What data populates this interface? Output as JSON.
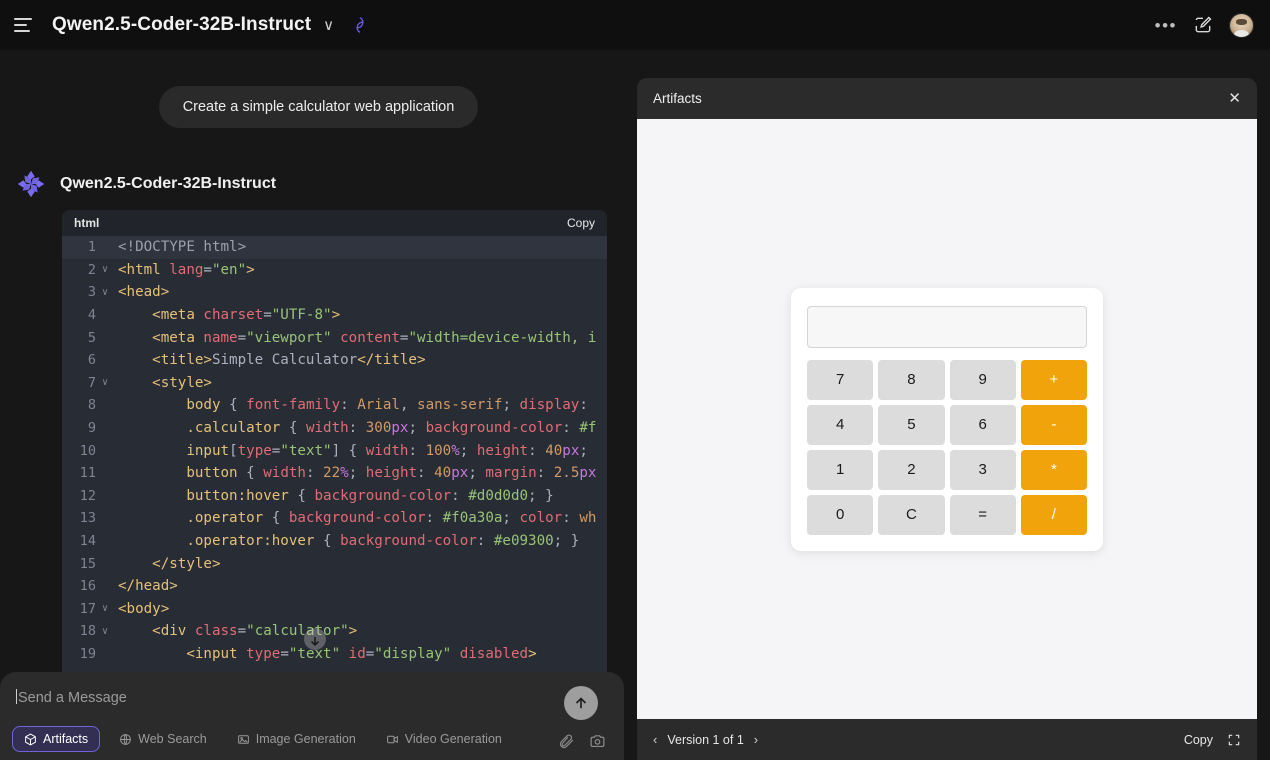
{
  "topbar": {
    "menu_icon": "hamburger-icon",
    "model_name": "Qwen2.5-Coder-32B-Instruct",
    "chevron": "∨",
    "brand_icon": "qwen-logo-icon",
    "more_label": "•••",
    "edit_icon": "edit-square-icon",
    "avatar_icon": "user-avatar"
  },
  "chat": {
    "user_message": "Create a simple calculator web application",
    "assistant_name": "Qwen2.5-Coder-32B-Instruct",
    "assistant_avatar": "qwen-logo-icon"
  },
  "code": {
    "language": "html",
    "copy_label": "Copy",
    "lines": [
      {
        "n": "1",
        "fold": "",
        "active": true
      },
      {
        "n": "2",
        "fold": "∨",
        "active": false
      },
      {
        "n": "3",
        "fold": "∨",
        "active": false
      },
      {
        "n": "4",
        "fold": "",
        "active": false
      },
      {
        "n": "5",
        "fold": "",
        "active": false
      },
      {
        "n": "6",
        "fold": "",
        "active": false
      },
      {
        "n": "7",
        "fold": "∨",
        "active": false
      },
      {
        "n": "8",
        "fold": "",
        "active": false
      },
      {
        "n": "9",
        "fold": "",
        "active": false
      },
      {
        "n": "10",
        "fold": "",
        "active": false
      },
      {
        "n": "11",
        "fold": "",
        "active": false
      },
      {
        "n": "12",
        "fold": "",
        "active": false
      },
      {
        "n": "13",
        "fold": "",
        "active": false
      },
      {
        "n": "14",
        "fold": "",
        "active": false
      },
      {
        "n": "15",
        "fold": "",
        "active": false
      },
      {
        "n": "16",
        "fold": "",
        "active": false
      },
      {
        "n": "17",
        "fold": "∨",
        "active": false
      },
      {
        "n": "18",
        "fold": "∨",
        "active": false
      },
      {
        "n": "19",
        "fold": "",
        "active": false
      }
    ],
    "text": {
      "l1": "<!DOCTYPE html>",
      "l2": "<html lang=\"en\">",
      "l3": "<head>",
      "l4": "    <meta charset=\"UTF-8\">",
      "l5": "    <meta name=\"viewport\" content=\"width=device-width, i",
      "l6": "    <title>Simple Calculator</title>",
      "l7": "    <style>",
      "l8": "        body { font-family: Arial, sans-serif; display: ",
      "l9": "        .calculator { width: 300px; background-color: #f",
      "l10": "        input[type=\"text\"] { width: 100%; height: 40px; ",
      "l11": "        button { width: 22%; height: 40px; margin: 2.5px",
      "l12": "        button:hover { background-color: #d0d0d0; }",
      "l13": "        .operator { background-color: #f0a30a; color: wh",
      "l14": "        .operator:hover { background-color: #e09300; }",
      "l15": "    </style>",
      "l16": "</head>",
      "l17": "<body>",
      "l18": "    <div class=\"calculator\">",
      "l19": "        <input type=\"text\" id=\"display\" disabled>"
    }
  },
  "composer": {
    "placeholder": "Send a Message",
    "value": "",
    "send_icon": "arrow-up-icon",
    "chips": [
      {
        "label": "Artifacts",
        "icon": "cube-icon",
        "active": true
      },
      {
        "label": "Web Search",
        "icon": "globe-icon",
        "active": false
      },
      {
        "label": "Image Generation",
        "icon": "image-icon",
        "active": false
      },
      {
        "label": "Video Generation",
        "icon": "video-icon",
        "active": false
      }
    ],
    "attach_icon": "paperclip-icon",
    "camera_icon": "camera-icon"
  },
  "artifacts": {
    "title": "Artifacts",
    "close_icon": "close-icon",
    "prev_icon": "‹",
    "next_icon": "›",
    "version_label": "Version 1 of 1",
    "copy_label": "Copy",
    "expand_icon": "fullscreen-icon"
  },
  "calculator": {
    "display_value": "",
    "buttons": [
      {
        "label": "7",
        "type": "digit"
      },
      {
        "label": "8",
        "type": "digit"
      },
      {
        "label": "9",
        "type": "digit"
      },
      {
        "label": "+",
        "type": "operator"
      },
      {
        "label": "4",
        "type": "digit"
      },
      {
        "label": "5",
        "type": "digit"
      },
      {
        "label": "6",
        "type": "digit"
      },
      {
        "label": "-",
        "type": "operator"
      },
      {
        "label": "1",
        "type": "digit"
      },
      {
        "label": "2",
        "type": "digit"
      },
      {
        "label": "3",
        "type": "digit"
      },
      {
        "label": "*",
        "type": "operator"
      },
      {
        "label": "0",
        "type": "digit"
      },
      {
        "label": "C",
        "type": "digit"
      },
      {
        "label": "=",
        "type": "digit"
      },
      {
        "label": "/",
        "type": "operator"
      }
    ]
  },
  "colors": {
    "accent_purple": "#6f63d6",
    "operator_orange": "#f0a30a",
    "code_bg": "#282c34",
    "page_bg": "#171717"
  }
}
